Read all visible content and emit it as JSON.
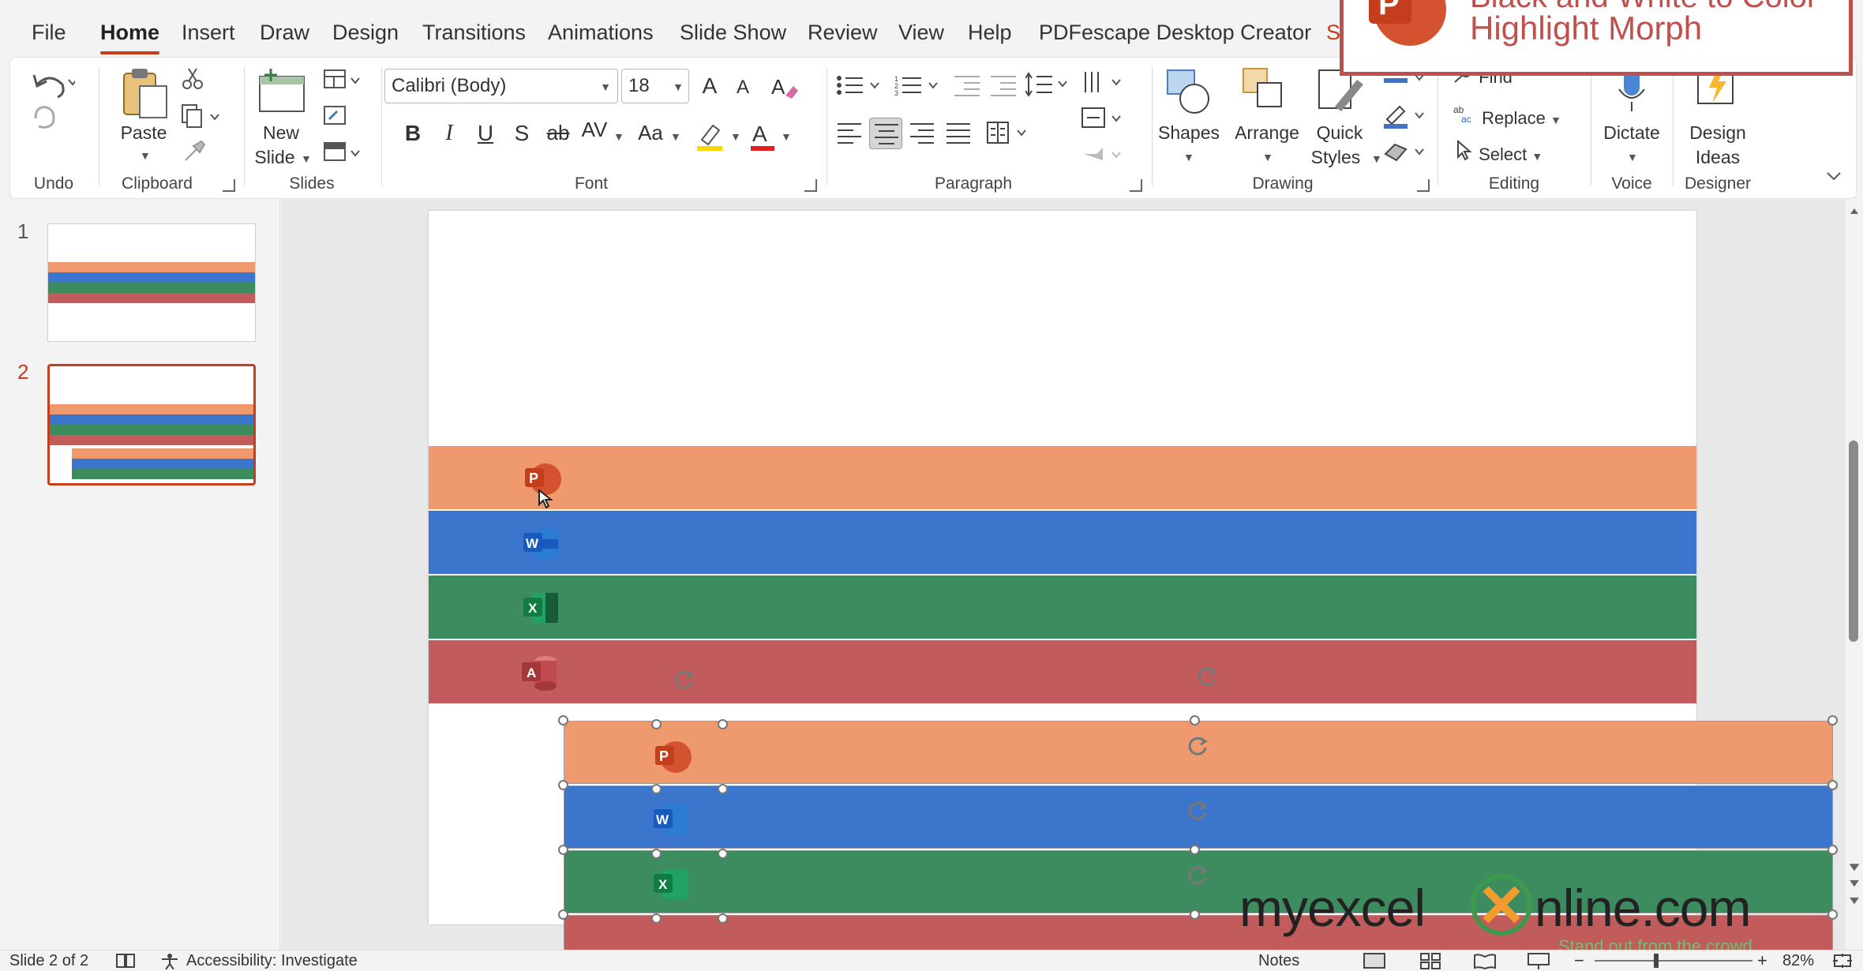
{
  "tabs": [
    "File",
    "Home",
    "Insert",
    "Draw",
    "Design",
    "Transitions",
    "Animations",
    "Slide Show",
    "Review",
    "View",
    "Help",
    "PDFescape Desktop Creator",
    "S"
  ],
  "active_tab": "Home",
  "ribbon": {
    "undo": {
      "label": "Undo"
    },
    "clipboard": {
      "label": "Clipboard",
      "paste": "Paste"
    },
    "slides": {
      "label": "Slides",
      "new_slide_1": "New",
      "new_slide_2": "Slide"
    },
    "font": {
      "label": "Font",
      "family": "Calibri (Body)",
      "size": "18",
      "bold": "B",
      "italic": "I",
      "underline": "U",
      "shadow": "S",
      "strike": "ab",
      "spacing": "AV",
      "case": "Aa",
      "grow": "A",
      "shrink": "A"
    },
    "paragraph": {
      "label": "Paragraph"
    },
    "drawing": {
      "label": "Drawing",
      "shapes": "Shapes",
      "arrange": "Arrange",
      "quick_styles_1": "Quick",
      "quick_styles_2": "Styles"
    },
    "editing": {
      "label": "Editing",
      "find": "Find",
      "replace": "Replace",
      "select": "Select"
    },
    "voice": {
      "label": "Voice",
      "dictate": "Dictate"
    },
    "designer": {
      "label": "Designer",
      "design_ideas_1": "Design",
      "design_ideas_2": "Ideas"
    }
  },
  "thumbnails": [
    "1",
    "2"
  ],
  "slide": {
    "apps": [
      {
        "letter": "P",
        "color": "#ee9a6e",
        "icon": "#d35230"
      },
      {
        "letter": "W",
        "color": "#3c75cc",
        "icon": "#185abd"
      },
      {
        "letter": "X",
        "color": "#3d8c5f",
        "icon": "#107c41"
      },
      {
        "letter": "A",
        "color": "#c25b5b",
        "icon": "#a4373a"
      }
    ]
  },
  "status": {
    "slide": "Slide 2 of 2",
    "accessibility": "Accessibility: Investigate",
    "notes": "Notes",
    "zoom": "82%"
  },
  "callout": {
    "title": "Highlight Morph",
    "line1": "Black and White to Color"
  },
  "watermark": {
    "brand": "myexcel",
    "brand2": "nline.com",
    "tagline": "Stand out from the crowd"
  }
}
